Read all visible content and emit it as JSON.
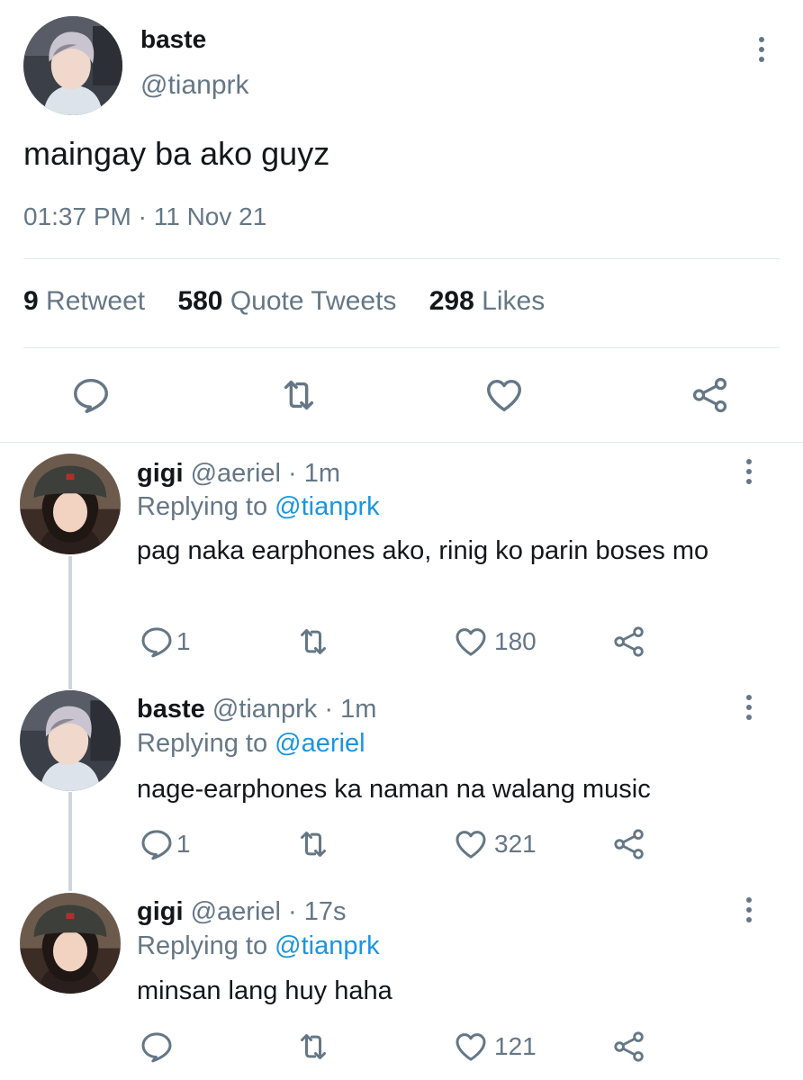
{
  "main": {
    "name": "baste",
    "handle": "@tianprk",
    "text": "maingay ba ako guyz",
    "timestamp": "01:37 PM · 11 Nov 21",
    "stats": {
      "retweets_count": "9",
      "retweets_label": "Retweet",
      "quotes_count": "580",
      "quotes_label": "Quote Tweets",
      "likes_count": "298",
      "likes_label": "Likes"
    }
  },
  "replies": [
    {
      "name": "gigi",
      "handle": "@aeriel",
      "sep": "·",
      "time": "1m",
      "replying_label": "Replying to",
      "replying_to": "@tianprk",
      "text": "pag naka earphones ako, rinig ko parin boses mo",
      "reply_count": "1",
      "like_count": "180"
    },
    {
      "name": "baste",
      "handle": "@tianprk",
      "sep": "·",
      "time": "1m",
      "replying_label": "Replying to",
      "replying_to": "@aeriel",
      "text": "nage-earphones ka naman na walang music",
      "reply_count": "1",
      "like_count": "321"
    },
    {
      "name": "gigi",
      "handle": "@aeriel",
      "sep": "·",
      "time": "17s",
      "replying_label": "Replying to",
      "replying_to": "@tianprk",
      "text": "minsan lang huy haha",
      "reply_count": "",
      "like_count": "121"
    }
  ],
  "icons": {
    "reply": "speech-bubble-icon",
    "retweet": "retweet-arrows-icon",
    "like": "heart-outline-icon",
    "share": "share-nodes-icon",
    "more": "vertical-dots-icon"
  },
  "colors": {
    "text": "#14171a",
    "muted": "#657786",
    "link": "#1b95e0",
    "divider": "#e1e8ed"
  }
}
